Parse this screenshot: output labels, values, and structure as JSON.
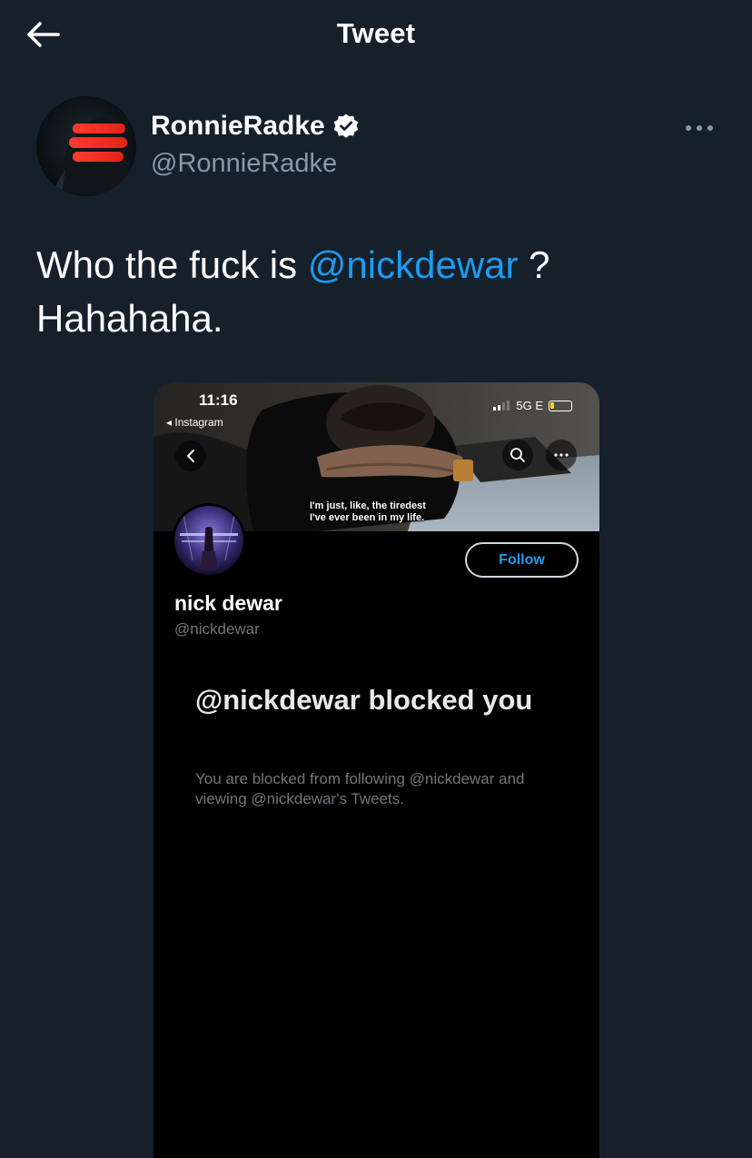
{
  "header": {
    "title": "Tweet",
    "back_icon": "arrow-left-icon"
  },
  "author": {
    "name": "RonnieRadke",
    "handle": "@RonnieRadke",
    "verified": true,
    "more_icon": "more-horizontal-icon"
  },
  "tweet": {
    "text_before": "Who the fuck is ",
    "mention": "@nickdewar",
    "text_after": " ? Hahahaha."
  },
  "media": {
    "status_bar": {
      "time": "11:16",
      "back_app": "◂ Instagram",
      "network": "5G E"
    },
    "banner_caption_line1": "I'm just, like, the tiredest",
    "banner_caption_line2": "I've ever been in my life.",
    "profile": {
      "name": "nick dewar",
      "handle": "@nickdewar",
      "follow_label": "Follow"
    },
    "blocked": {
      "title": "@nickdewar blocked you",
      "description": "You are blocked from following @nickdewar and viewing @nickdewar's Tweets."
    }
  },
  "colors": {
    "background": "#15202b",
    "accent": "#1d9bf0",
    "secondary_text": "#8b98a5"
  }
}
